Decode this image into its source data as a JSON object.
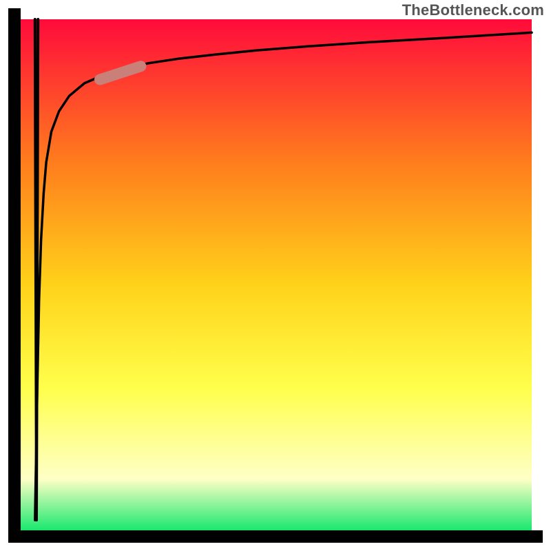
{
  "attribution": "TheBottleneck.com",
  "palette": {
    "grad_top": "#ff0b3b",
    "grad_upper_mid": "#ff7d1d",
    "grad_mid": "#ffd21a",
    "grad_lower_yellow": "#ffff4b",
    "grad_pale_yellow": "#feffc6",
    "grad_bottom": "#19e86e",
    "axis": "#000000",
    "curve": "#000000",
    "highlight": "#c98079"
  },
  "chart_data": {
    "type": "line",
    "title": "",
    "xlabel": "",
    "ylabel": "",
    "categories": [],
    "series": [
      {
        "name": "bottleneck-curve",
        "x": [
          0.028,
          0.033,
          0.036,
          0.04,
          0.045,
          0.05,
          0.06,
          0.075,
          0.095,
          0.125,
          0.16,
          0.2,
          0.25,
          0.31,
          0.38,
          0.46,
          0.56,
          0.68,
          0.82,
          1.0
        ],
        "values": [
          0.02,
          0.3,
          0.45,
          0.57,
          0.66,
          0.72,
          0.78,
          0.82,
          0.85,
          0.875,
          0.89,
          0.903,
          0.914,
          0.923,
          0.931,
          0.939,
          0.947,
          0.955,
          0.963,
          0.974
        ]
      },
      {
        "name": "spike",
        "x": [
          0.028,
          0.031,
          0.034
        ],
        "values": [
          1.0,
          0.02,
          1.0
        ]
      }
    ],
    "highlight_segment": {
      "x_start": 0.155,
      "y_start": 0.882,
      "x_end": 0.235,
      "y_end": 0.908
    },
    "xlim": [
      0,
      1
    ],
    "ylim": [
      0,
      1
    ]
  }
}
